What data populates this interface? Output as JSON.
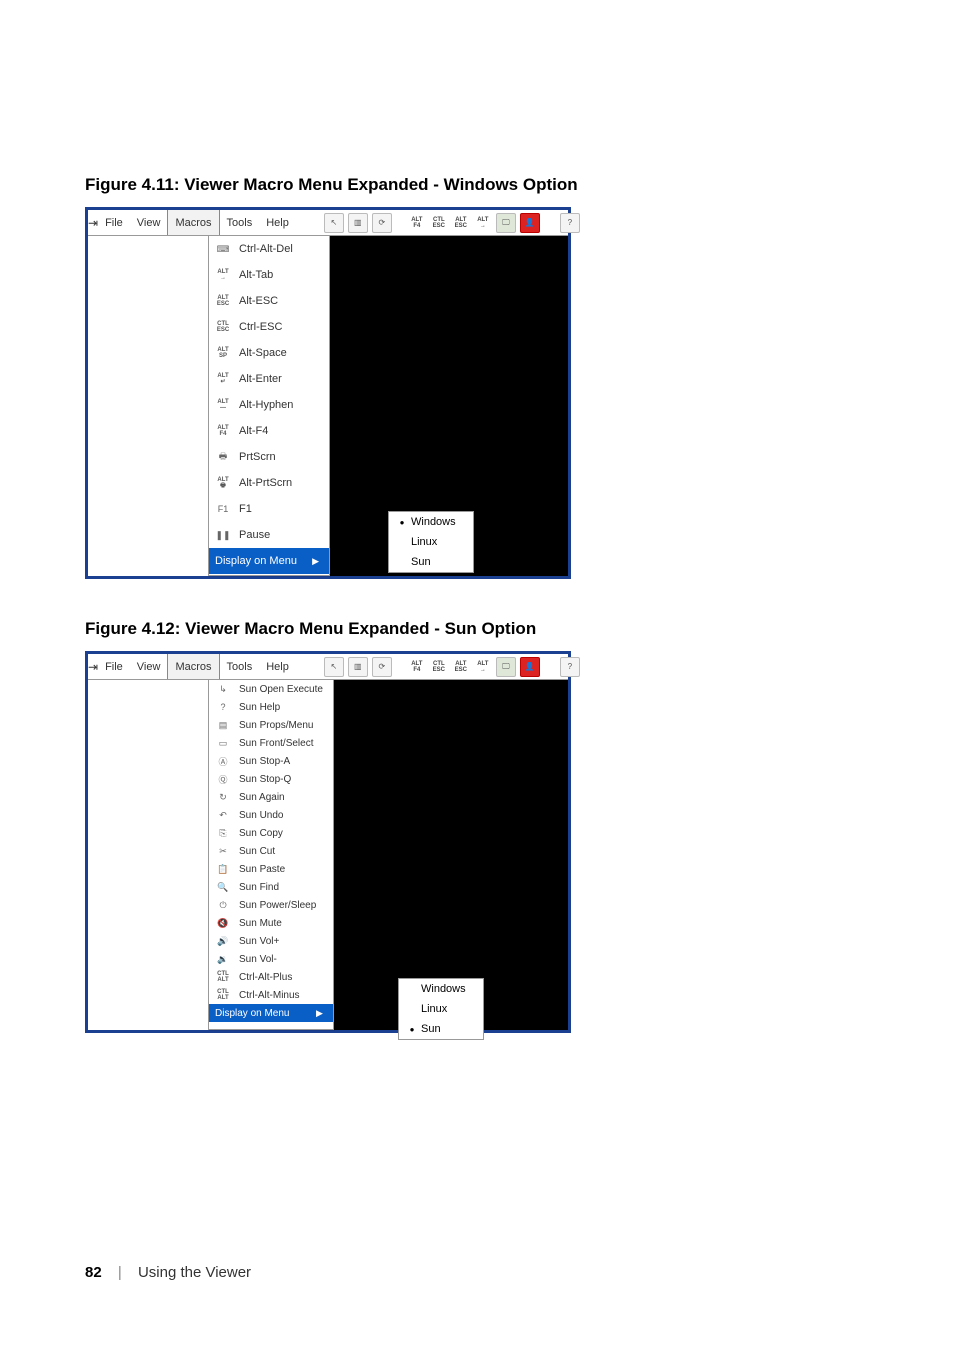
{
  "figure1": {
    "caption": "Figure 4.11: Viewer Macro Menu Expanded - Windows Option",
    "menubar": [
      "File",
      "View",
      "Macros",
      "Tools",
      "Help"
    ],
    "menubar_active": "Macros",
    "toolbar_text_icons": [
      "ALT\nF4",
      "CTL\nESC",
      "ALT\nESC",
      "ALT\n→"
    ],
    "dropdown": [
      {
        "icon": "⌨",
        "label": "Ctrl-Alt-Del"
      },
      {
        "icon": "ALT\n→",
        "label": "Alt-Tab"
      },
      {
        "icon": "ALT\nESC",
        "label": "Alt-ESC"
      },
      {
        "icon": "CTL\nESC",
        "label": "Ctrl-ESC"
      },
      {
        "icon": "ALT\nSP",
        "label": "Alt-Space"
      },
      {
        "icon": "ALT\n↵",
        "label": "Alt-Enter"
      },
      {
        "icon": "ALT\n—",
        "label": "Alt-Hyphen"
      },
      {
        "icon": "ALT\nF4",
        "label": "Alt-F4"
      },
      {
        "icon": "🖶",
        "label": "PrtScrn"
      },
      {
        "icon": "ALT\n🖶",
        "label": "Alt-PrtScrn"
      },
      {
        "icon": "F1",
        "label": "F1"
      },
      {
        "icon": "❚❚",
        "label": "Pause"
      }
    ],
    "display_on_menu": "Display on Menu",
    "submenu": [
      "Windows",
      "Linux",
      "Sun"
    ],
    "submenu_selected": "Windows"
  },
  "figure2": {
    "caption": "Figure 4.12: Viewer Macro Menu Expanded - Sun Option",
    "menubar": [
      "File",
      "View",
      "Macros",
      "Tools",
      "Help"
    ],
    "menubar_active": "Macros",
    "toolbar_text_icons": [
      "ALT\nF4",
      "CTL\nESC",
      "ALT\nESC",
      "ALT\n→"
    ],
    "dropdown": [
      {
        "icon": "↳",
        "label": "Sun Open Execute"
      },
      {
        "icon": "?",
        "label": "Sun Help"
      },
      {
        "icon": "▤",
        "label": "Sun Props/Menu"
      },
      {
        "icon": "▭",
        "label": "Sun Front/Select"
      },
      {
        "icon": "Ⓐ",
        "label": "Sun Stop-A"
      },
      {
        "icon": "Ⓠ",
        "label": "Sun Stop-Q"
      },
      {
        "icon": "↻",
        "label": "Sun Again"
      },
      {
        "icon": "↶",
        "label": "Sun Undo"
      },
      {
        "icon": "⎘",
        "label": "Sun Copy"
      },
      {
        "icon": "✂",
        "label": "Sun Cut"
      },
      {
        "icon": "📋",
        "label": "Sun Paste"
      },
      {
        "icon": "🔍",
        "label": "Sun Find"
      },
      {
        "icon": "⏻",
        "label": "Sun Power/Sleep"
      },
      {
        "icon": "🔇",
        "label": "Sun Mute"
      },
      {
        "icon": "🔊",
        "label": "Sun Vol+"
      },
      {
        "icon": "🔉",
        "label": "Sun Vol-"
      },
      {
        "icon": "CTL\nALT",
        "label": "Ctrl-Alt-Plus"
      },
      {
        "icon": "CTL\nALT",
        "label": "Ctrl-Alt-Minus"
      }
    ],
    "display_on_menu": "Display on Menu",
    "submenu": [
      "Windows",
      "Linux",
      "Sun"
    ],
    "submenu_selected": "Sun"
  },
  "footer": {
    "page": "82",
    "title": "Using the Viewer"
  }
}
